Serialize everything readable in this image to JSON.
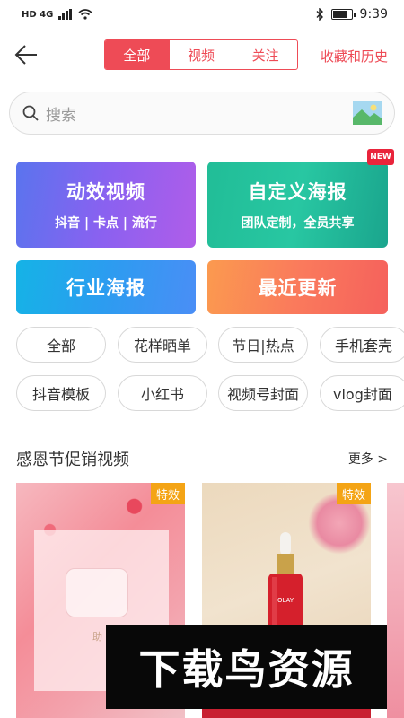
{
  "status_bar": {
    "network": "HD 4G",
    "time": "9:39",
    "battery_level": 0.85
  },
  "header": {
    "tabs": [
      {
        "label": "全部",
        "active": true
      },
      {
        "label": "视频",
        "active": false
      },
      {
        "label": "关注",
        "active": false
      }
    ],
    "history_link": "收藏和历史"
  },
  "search": {
    "placeholder": "搜索"
  },
  "cards": {
    "motion_video": {
      "title": "动效视频",
      "subtitle": "抖音 | 卡点 | 流行"
    },
    "custom_poster": {
      "title": "自定义海报",
      "subtitle": "团队定制，全员共享",
      "badge": "NEW"
    },
    "industry_poster": {
      "title": "行业海报"
    },
    "recent_updates": {
      "title": "最近更新"
    }
  },
  "chips_row1": [
    "全部",
    "花样晒单",
    "节日|热点",
    "手机套壳"
  ],
  "chips_row2": [
    "抖音模板",
    "小红书",
    "视频号封面",
    "vlog封面"
  ],
  "section": {
    "title": "感恩节促销视频",
    "more": "更多 >"
  },
  "thumbnails": [
    {
      "tag": "特效",
      "caption": "助 梦 12.8"
    },
    {
      "tag": "特效",
      "product_text": "OLAY"
    }
  ],
  "watermark": "下载鸟资源",
  "colors": {
    "accent": "#ee4b56",
    "tag": "#f4a415"
  }
}
